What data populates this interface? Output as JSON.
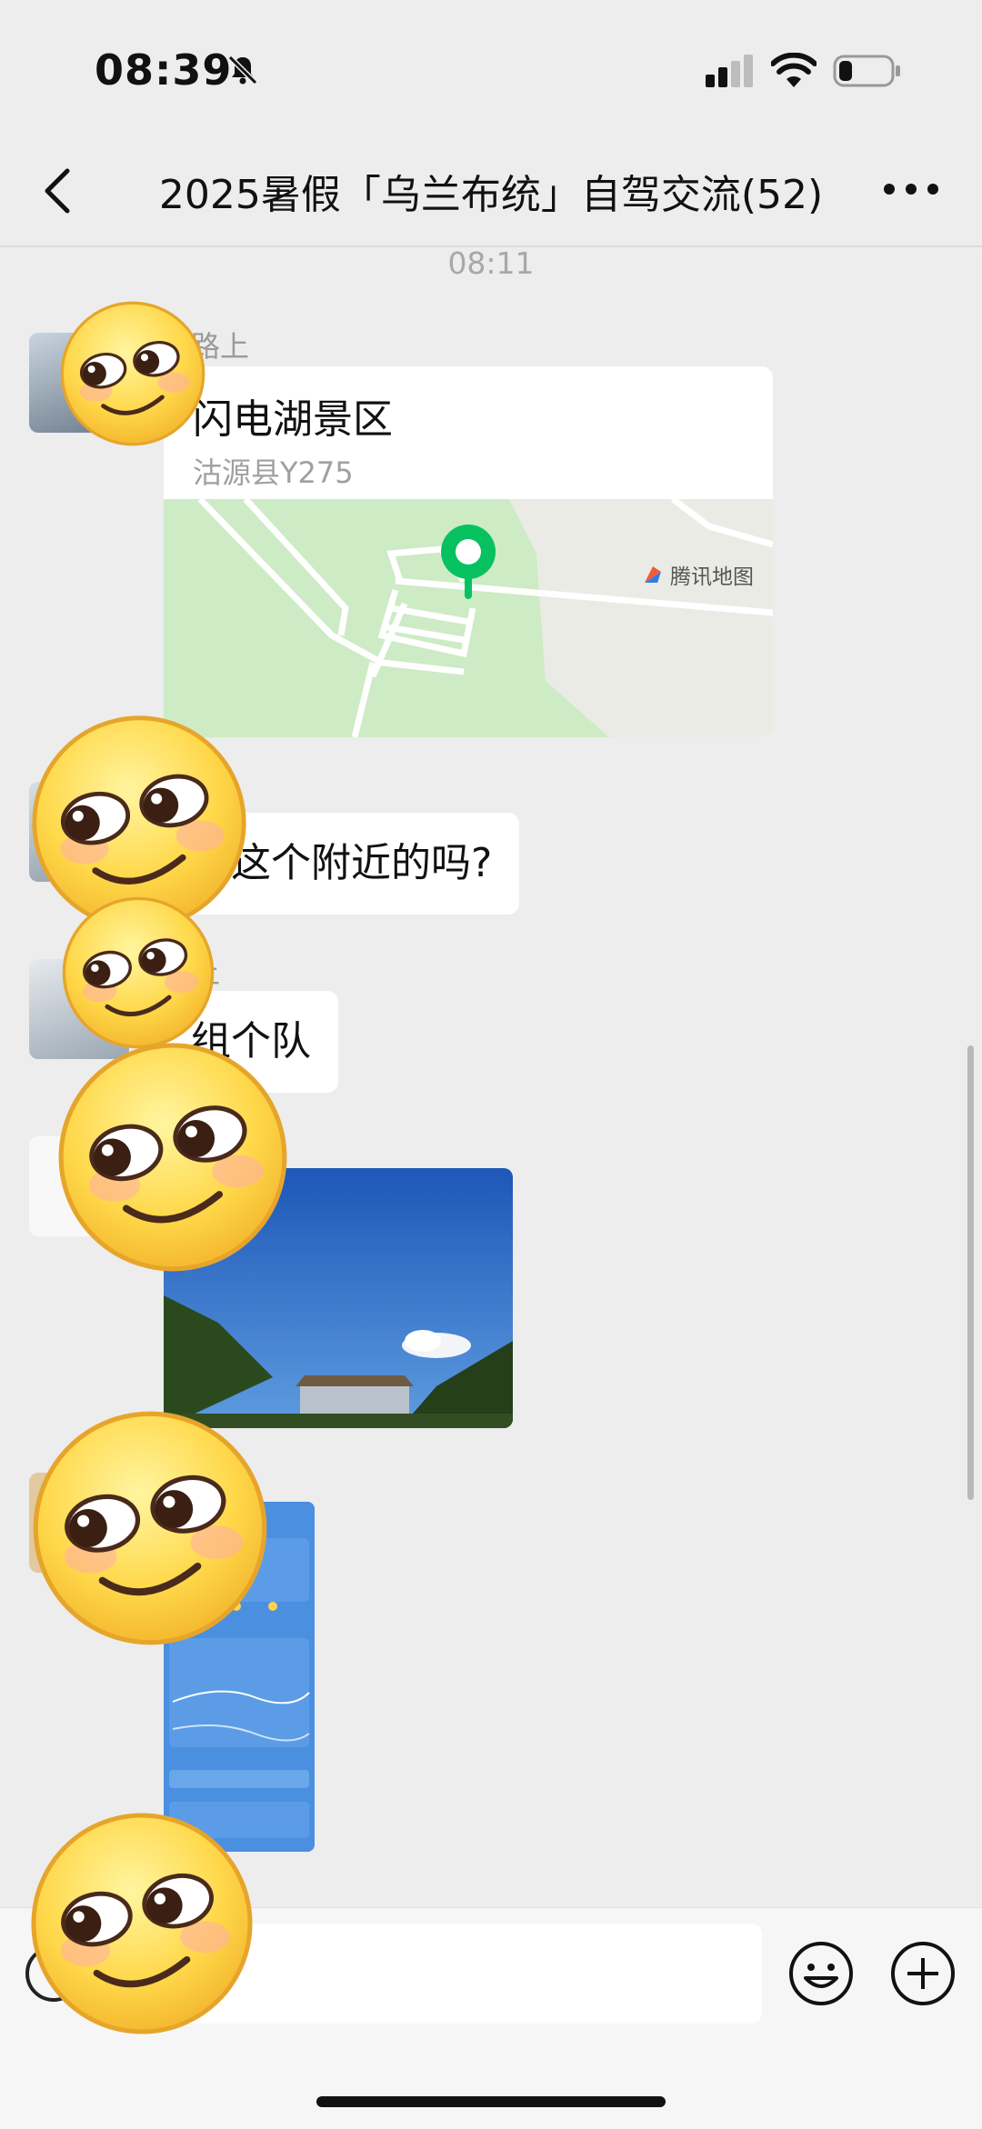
{
  "status_bar": {
    "time": "08:39"
  },
  "nav": {
    "title": "2025暑假「乌兰布统」自驾交流(52)"
  },
  "chat": {
    "timestamp": "08:11",
    "messages": [
      {
        "sender": "路上",
        "location_title": "闪电湖景区",
        "location_address": "沽源县Y275",
        "map_provider": "腾讯地图"
      },
      {
        "sender": "",
        "text": "在这个附近的吗?"
      },
      {
        "sender": "上",
        "text": "组个队"
      }
    ]
  },
  "input_bar": {
    "placeholder": ""
  },
  "colors": {
    "background": "#ededed",
    "bubble": "#ffffff",
    "map_pin": "#07c160",
    "map_green": "#cdebc5"
  },
  "icons": [
    "back-icon",
    "more-icon",
    "bell-slash-icon",
    "signal-icon",
    "wifi-icon",
    "battery-icon",
    "voice-icon",
    "emoji-icon",
    "plus-icon"
  ]
}
